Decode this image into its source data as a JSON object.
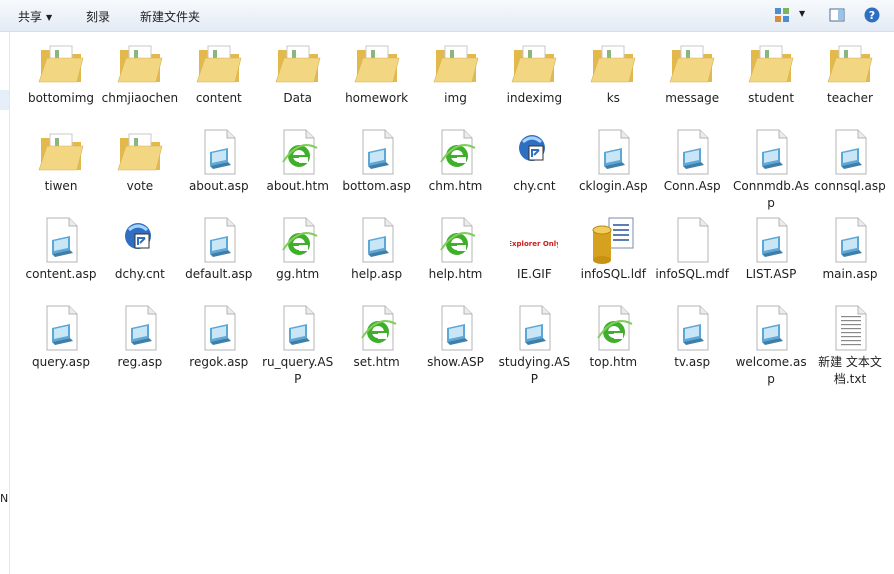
{
  "toolbar": {
    "share_label": "共享",
    "burn_label": "刻录",
    "new_folder_label": "新建文件夹"
  },
  "sidebar_fragment": "N",
  "files": [
    {
      "name": "bottomimg",
      "icon": "folder-icon"
    },
    {
      "name": "chmjiaochen",
      "icon": "folder-icon"
    },
    {
      "name": "content",
      "icon": "folder-icon"
    },
    {
      "name": "Data",
      "icon": "folder-icon"
    },
    {
      "name": "homework",
      "icon": "folder-icon"
    },
    {
      "name": "img",
      "icon": "folder-icon"
    },
    {
      "name": "indeximg",
      "icon": "folder-icon"
    },
    {
      "name": "ks",
      "icon": "folder-icon"
    },
    {
      "name": "message",
      "icon": "folder-icon"
    },
    {
      "name": "student",
      "icon": "folder-icon"
    },
    {
      "name": "teacher",
      "icon": "folder-icon"
    },
    {
      "name": "tiwen",
      "icon": "folder-icon"
    },
    {
      "name": "vote",
      "icon": "folder-icon"
    },
    {
      "name": "about.asp",
      "icon": "asp-file-icon"
    },
    {
      "name": "about.htm",
      "icon": "ie-htm-file-icon"
    },
    {
      "name": "bottom.asp",
      "icon": "asp-file-icon"
    },
    {
      "name": "chm.htm",
      "icon": "ie-htm-file-icon"
    },
    {
      "name": "chy.cnt",
      "icon": "help-contents-icon"
    },
    {
      "name": "cklogin.Asp",
      "icon": "asp-file-icon"
    },
    {
      "name": "Conn.Asp",
      "icon": "asp-file-icon"
    },
    {
      "name": "Connmdb.Asp",
      "icon": "asp-file-icon"
    },
    {
      "name": "connsql.asp",
      "icon": "asp-file-icon"
    },
    {
      "name": "content.asp",
      "icon": "asp-file-icon"
    },
    {
      "name": "dchy.cnt",
      "icon": "help-contents-icon"
    },
    {
      "name": "default.asp",
      "icon": "asp-file-icon"
    },
    {
      "name": "gg.htm",
      "icon": "ie-htm-file-icon"
    },
    {
      "name": "help.asp",
      "icon": "asp-file-icon"
    },
    {
      "name": "help.htm",
      "icon": "ie-htm-file-icon"
    },
    {
      "name": "IE.GIF",
      "icon": "gif-image-icon",
      "thumb_text": "Explorer Only"
    },
    {
      "name": "infoSQL.ldf",
      "icon": "database-icon"
    },
    {
      "name": "infoSQL.mdf",
      "icon": "blank-file-icon"
    },
    {
      "name": "LIST.ASP",
      "icon": "asp-file-icon"
    },
    {
      "name": "main.asp",
      "icon": "asp-file-icon"
    },
    {
      "name": "query.asp",
      "icon": "asp-file-icon"
    },
    {
      "name": "reg.asp",
      "icon": "asp-file-icon"
    },
    {
      "name": "regok.asp",
      "icon": "asp-file-icon"
    },
    {
      "name": "ru_query.ASP",
      "icon": "asp-file-icon"
    },
    {
      "name": "set.htm",
      "icon": "ie-htm-file-icon"
    },
    {
      "name": "show.ASP",
      "icon": "asp-file-icon"
    },
    {
      "name": "studying.ASP",
      "icon": "asp-file-icon"
    },
    {
      "name": "top.htm",
      "icon": "ie-htm-file-icon"
    },
    {
      "name": "tv.asp",
      "icon": "asp-file-icon"
    },
    {
      "name": "welcome.asp",
      "icon": "asp-file-icon"
    },
    {
      "name": "新建 文本文档.txt",
      "icon": "text-file-icon"
    }
  ],
  "colors": {
    "folder": "#f3d682",
    "ie_green": "#3fae2a",
    "asp_blue": "#5aa7d8",
    "selection": "#e5eef9"
  }
}
